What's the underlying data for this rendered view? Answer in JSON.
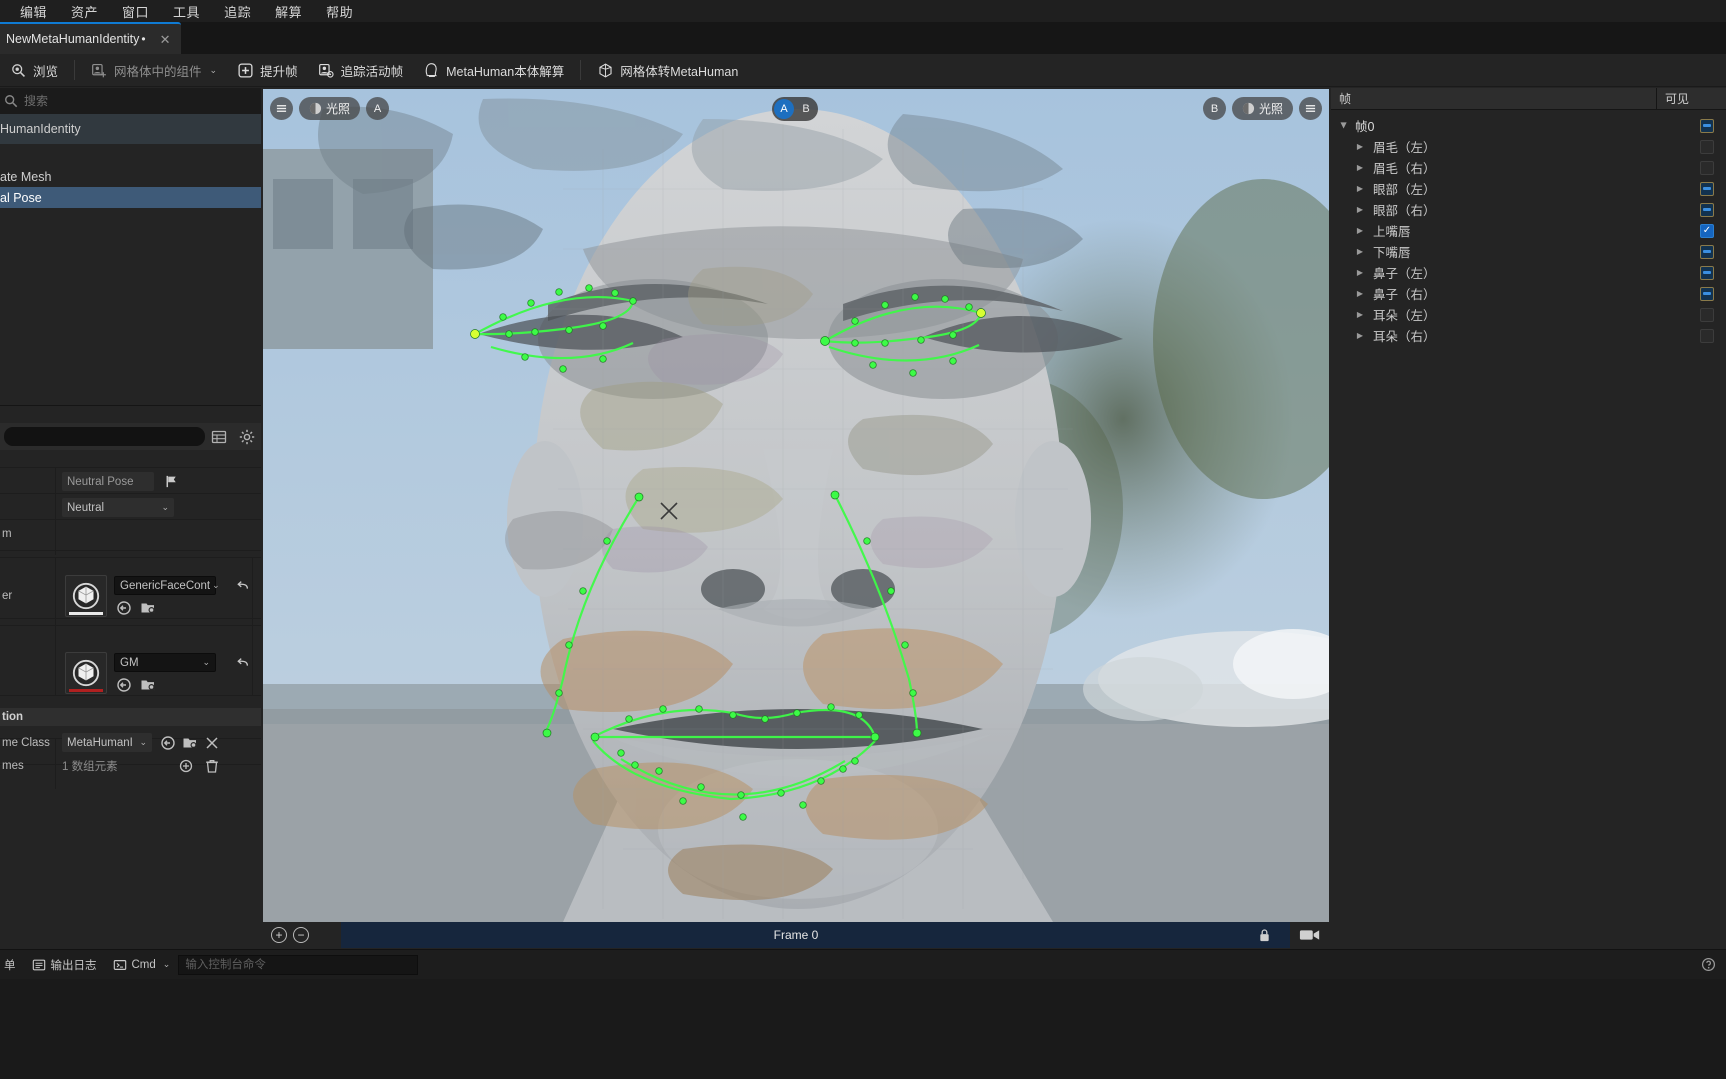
{
  "menu": {
    "items": [
      {
        "label": "编辑",
        "name": "menu-edit"
      },
      {
        "label": "资产",
        "name": "menu-asset"
      },
      {
        "label": "窗口",
        "name": "menu-window"
      },
      {
        "label": "工具",
        "name": "menu-tools"
      },
      {
        "label": "追踪",
        "name": "menu-track"
      },
      {
        "label": "解算",
        "name": "menu-solve"
      },
      {
        "label": "帮助",
        "name": "menu-help"
      }
    ]
  },
  "tab": {
    "label": "NewMetaHumanIdentity",
    "dirty_marker": "•",
    "close": "✕"
  },
  "toolbar": {
    "browse": "浏览",
    "components": "网格体中的组件",
    "promote_frame": "提升帧",
    "track_active_frame": "追踪活动帧",
    "metahuman_solve": "MetaHuman本体解算",
    "mesh_to_metahuman": "网格体转MetaHuman",
    "caret": "⌄"
  },
  "outliner": {
    "search_placeholder": "搜索",
    "items": [
      {
        "label": "HumanIdentity",
        "state": "header"
      },
      {
        "label": "ate Mesh",
        "state": "normal"
      },
      {
        "label": "al Pose",
        "state": "selected"
      }
    ]
  },
  "details": {
    "rows": {
      "neutral_pose_value": "Neutral Pose",
      "neutral_dropdown": "Neutral",
      "frame_label": "m",
      "conformer_label": "er",
      "conformer_value": "GenericFaceCont",
      "material_value": "GM",
      "section_title": "tion",
      "frame_class_label": "me Class",
      "frame_class_value": "MetaHumanI",
      "frames_label": "mes",
      "frames_value": "1 数组元素",
      "caret": "⌄",
      "revert": "↺"
    },
    "accent_underline_white": "#e8e8e8",
    "accent_underline_red": "#b02020"
  },
  "viewport": {
    "left_lighting": "光照",
    "left_a": "A",
    "right_b": "B",
    "right_lighting": "光照",
    "ab_a": "A",
    "ab_b": "B",
    "timeline_frame": "Frame 0",
    "zoom_in": "+",
    "zoom_out": "−"
  },
  "frames_panel": {
    "col_name": "帧",
    "col_visible": "可见",
    "root": {
      "label": "帧0",
      "checkbox": "partial"
    },
    "items": [
      {
        "label": "眉毛（左）",
        "checkbox": "empty"
      },
      {
        "label": "眉毛（右）",
        "checkbox": "empty"
      },
      {
        "label": "眼部（左）",
        "checkbox": "partial"
      },
      {
        "label": "眼部（右）",
        "checkbox": "partial"
      },
      {
        "label": "上嘴唇",
        "checkbox": "checked"
      },
      {
        "label": "下嘴唇",
        "checkbox": "partial"
      },
      {
        "label": "鼻子（左）",
        "checkbox": "partial"
      },
      {
        "label": "鼻子（右）",
        "checkbox": "partial"
      },
      {
        "label": "耳朵（左）",
        "checkbox": "empty"
      },
      {
        "label": "耳朵（右）",
        "checkbox": "empty"
      }
    ]
  },
  "statusbar": {
    "menu_label": "单",
    "output_log": "输出日志",
    "cmd_label": "Cmd",
    "cmd_placeholder": "输入控制台命令",
    "caret": "⌄"
  },
  "colors": {
    "accent_blue": "#1e86e0",
    "selection_blue": "#3e5a78",
    "timeline_blue": "#16263d",
    "panel_bg": "#242424",
    "landmark_green": "#3dfb47"
  }
}
